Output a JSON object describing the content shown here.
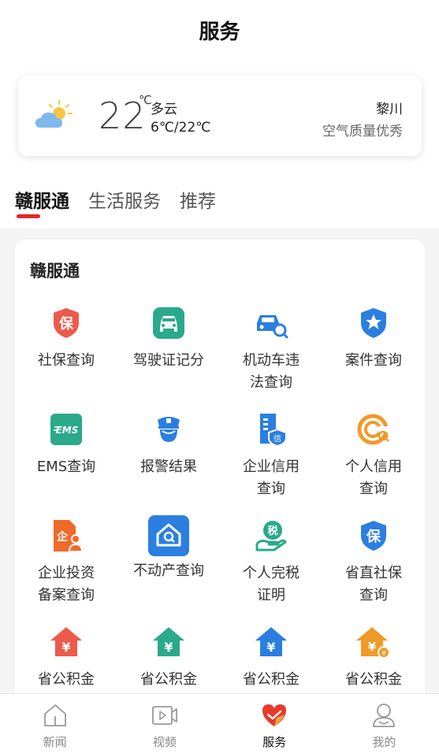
{
  "header": {
    "title": "服务"
  },
  "weather": {
    "temp": "22",
    "unit": "℃",
    "condition": "多云",
    "range": "6℃/22℃",
    "city": "黎川",
    "air_quality": "空气质量优秀",
    "icon": "partly-cloudy-icon"
  },
  "tabs": [
    {
      "label": "赣服通",
      "active": true
    },
    {
      "label": "生活服务",
      "active": false
    },
    {
      "label": "推荐",
      "active": false
    }
  ],
  "section": {
    "title": "赣服通",
    "items": [
      {
        "label": "社保查询",
        "icon": "shield-bao-icon",
        "color": "#ec5a4a"
      },
      {
        "label": "驾驶证记分",
        "icon": "car-icon",
        "color": "#2aa98b"
      },
      {
        "label": "机动车违\n法查询",
        "icon": "car-search-icon",
        "color": "#2a7fe0"
      },
      {
        "label": "案件查询",
        "icon": "star-shield-icon",
        "color": "#2a7fe0"
      },
      {
        "label": "EMS查询",
        "icon": "ems-icon",
        "color": "#2aa98b"
      },
      {
        "label": "报警结果",
        "icon": "police-icon",
        "color": "#2a7fe0"
      },
      {
        "label": "企业信用\n查询",
        "icon": "building-credit-icon",
        "color": "#2a7fe0"
      },
      {
        "label": "个人信用\n查询",
        "icon": "credit-c-icon",
        "color": "#f09a2a"
      },
      {
        "label": "企业投资\n备案查询",
        "icon": "doc-invest-icon",
        "color": "#f06a2a"
      },
      {
        "label": "不动产查询",
        "icon": "house-search-icon",
        "color": "#2a7fe0"
      },
      {
        "label": "个人完税\n证明",
        "icon": "tax-hand-icon",
        "color": "#2aa98b"
      },
      {
        "label": "省直社保\n查询",
        "icon": "shield-bao-blue-icon",
        "color": "#2a7fe0"
      },
      {
        "label": "省公积金",
        "icon": "house-yen-red-icon",
        "color": "#ec5a4a"
      },
      {
        "label": "省公积金",
        "icon": "house-yen-green-icon",
        "color": "#2aa98b"
      },
      {
        "label": "省公积金",
        "icon": "house-yen-blue-icon",
        "color": "#2a7fe0"
      },
      {
        "label": "省公积金",
        "icon": "house-yen-orange-icon",
        "color": "#f09a2a"
      }
    ]
  },
  "bottom_nav": [
    {
      "label": "新闻",
      "icon": "home-icon",
      "active": false
    },
    {
      "label": "视频",
      "icon": "video-icon",
      "active": false
    },
    {
      "label": "服务",
      "icon": "heart-service-icon",
      "active": true
    },
    {
      "label": "我的",
      "icon": "user-icon",
      "active": false
    }
  ]
}
